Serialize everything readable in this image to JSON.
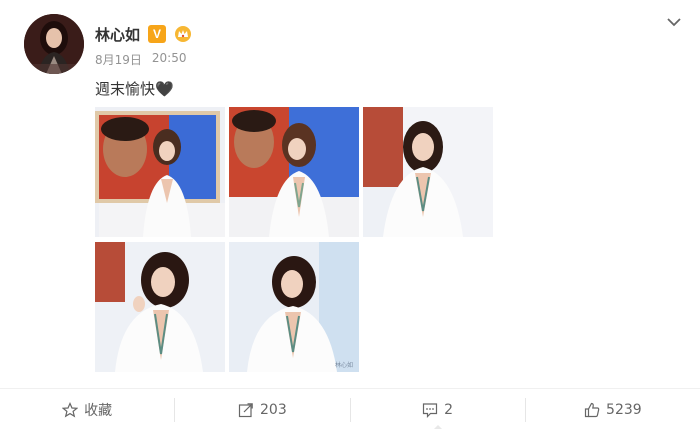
{
  "post": {
    "author": {
      "name": "林心如",
      "verified_mark": "V",
      "avatar_icon": "avatar-photo"
    },
    "meta": {
      "date": "8月19日",
      "time": "20:50"
    },
    "text": "週末愉快🖤",
    "photos": [
      {
        "id": "photo-1",
        "description_icon": "photo-thumbnail"
      },
      {
        "id": "photo-2",
        "description_icon": "photo-thumbnail"
      },
      {
        "id": "photo-3",
        "description_icon": "photo-thumbnail"
      },
      {
        "id": "photo-4",
        "description_icon": "photo-thumbnail"
      },
      {
        "id": "photo-5",
        "description_icon": "photo-thumbnail",
        "watermark": "林心如"
      }
    ],
    "actions": {
      "favorite_label": "收藏",
      "repost_count": "203",
      "comment_count": "2",
      "like_count": "5239"
    },
    "colors": {
      "verified_badge": "#f7a519",
      "meta_text": "#939393",
      "action_text": "#666666"
    }
  }
}
